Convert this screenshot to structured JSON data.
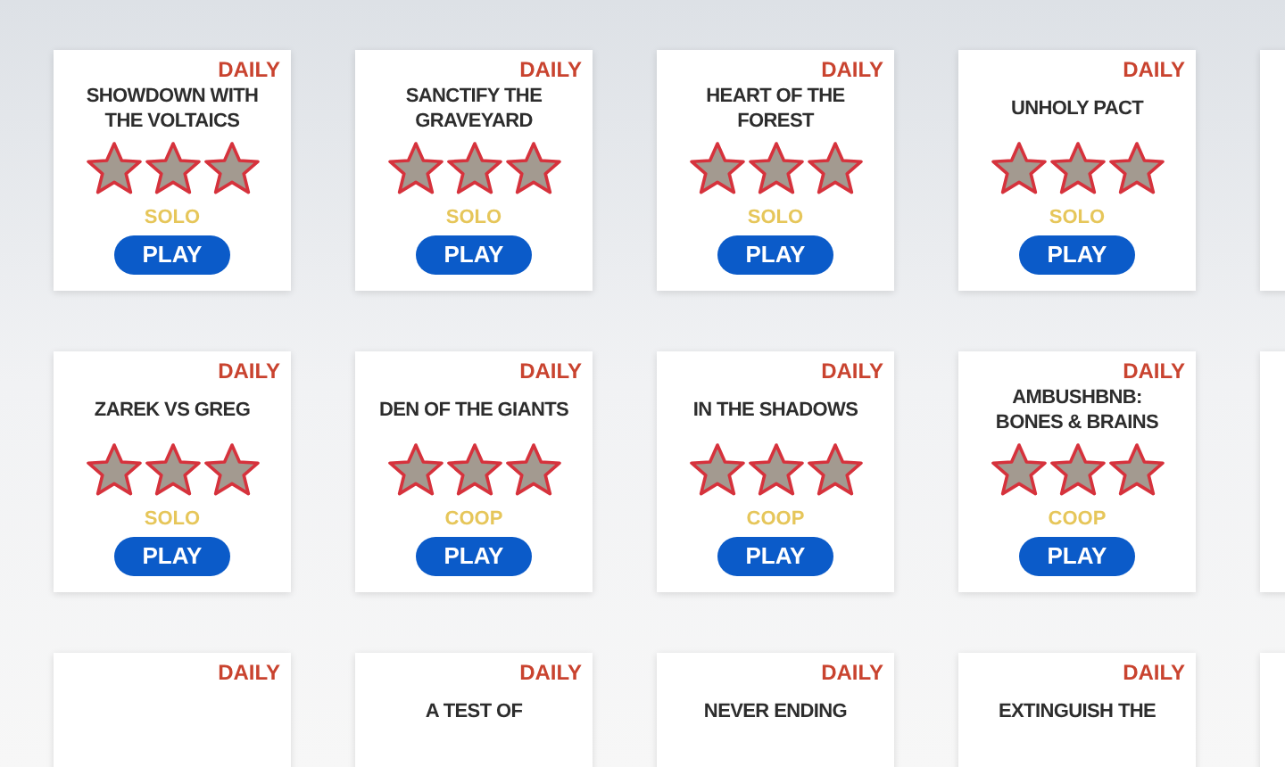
{
  "rows": [
    {
      "cards": [
        {
          "badge": "DAILY",
          "title": [
            "SHOWDOWN WITH",
            "THE VOLTAICS"
          ],
          "stars": 3,
          "mode": "SOLO",
          "button": "PLAY"
        },
        {
          "badge": "DAILY",
          "title": [
            "SANCTIFY THE",
            "GRAVEYARD"
          ],
          "stars": 3,
          "mode": "SOLO",
          "button": "PLAY"
        },
        {
          "badge": "DAILY",
          "title": [
            "HEART OF THE",
            "FOREST"
          ],
          "stars": 3,
          "mode": "SOLO",
          "button": "PLAY"
        },
        {
          "badge": "DAILY",
          "title": [
            "UNHOLY PACT"
          ],
          "stars": 3,
          "mode": "SOLO",
          "button": "PLAY"
        }
      ]
    },
    {
      "cards": [
        {
          "badge": "DAILY",
          "title": [
            "ZAREK VS GREG"
          ],
          "stars": 3,
          "mode": "SOLO",
          "button": "PLAY"
        },
        {
          "badge": "DAILY",
          "title": [
            "DEN OF THE GIANTS"
          ],
          "stars": 3,
          "mode": "COOP",
          "button": "PLAY"
        },
        {
          "badge": "DAILY",
          "title": [
            "IN THE SHADOWS"
          ],
          "stars": 3,
          "mode": "COOP",
          "button": "PLAY"
        },
        {
          "badge": "DAILY",
          "title": [
            "AMBUSHBNB:",
            "BONES & BRAINS"
          ],
          "stars": 3,
          "mode": "COOP",
          "button": "PLAY"
        }
      ]
    },
    {
      "cards": [
        {
          "badge": "DAILY"
        },
        {
          "badge": "DAILY",
          "title": [
            "A TEST OF"
          ]
        },
        {
          "badge": "DAILY",
          "title": [
            "NEVER ENDING"
          ]
        },
        {
          "badge": "DAILY",
          "title": [
            "EXTINGUISH THE"
          ]
        }
      ]
    }
  ]
}
